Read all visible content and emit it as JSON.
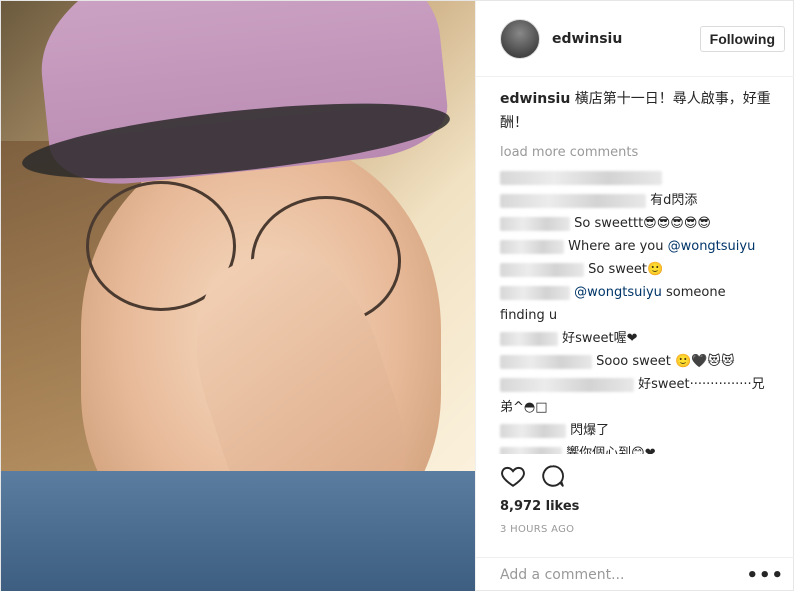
{
  "post": {
    "username": "edwinsiu",
    "follow_label": "Following",
    "caption_user": "edwinsiu",
    "caption_text": "橫店第十一日！尋人啟事，好重酬！",
    "load_more": "load more comments",
    "likes": "8,972 likes",
    "time": "3 HOURS AGO",
    "add_comment_placeholder": "Add a comment...",
    "more_options": "•••"
  },
  "comments": [
    {
      "text": ""
    },
    {
      "text": "有d閃添"
    },
    {
      "text": "So sweettt😎😎😎😎😎"
    },
    {
      "text": "Where are you ",
      "mention": "@wongtsuiyu"
    },
    {
      "text": "So sweet🙂"
    },
    {
      "mention": "@wongtsuiyu",
      "text": " someone finding u"
    },
    {
      "text": "好sweet喔❤"
    },
    {
      "text": "Sooo sweet 🙂🖤😻😻"
    },
    {
      "text": "好sweet···············兄弟^◓□"
    },
    {
      "text": "閃爆了"
    },
    {
      "text": "響你個心到😊❤"
    }
  ],
  "colors": {
    "mention": "#003569",
    "muted": "#999999",
    "border": "#dbdbdb"
  },
  "icons": {
    "like": "heart-icon",
    "comment": "comment-icon"
  }
}
